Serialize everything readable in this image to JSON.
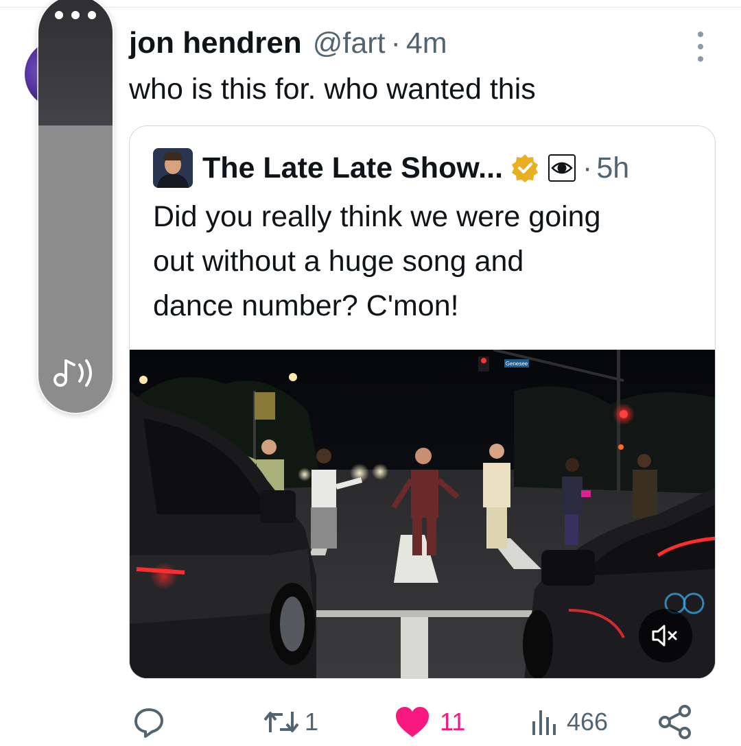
{
  "tweet": {
    "author_name": "jon hendren",
    "handle": "@fart",
    "separator": "·",
    "time": "4m",
    "text": "who is this for. who wanted this",
    "avatar_icon": "avatar-image",
    "more_icon": "more-vertical-icon"
  },
  "quote": {
    "author_name": "The Late Late Show...",
    "verified_icon": "verified-badge-icon",
    "network_icon": "cbs-eye-logo",
    "separator": "·",
    "time": "5h",
    "text_lines": [
      "Did you really think we were going",
      "out without a huge song and",
      "dance number? C'mon!"
    ],
    "media": {
      "street_sign": "Genesee",
      "mute_icon": "volume-muted-icon"
    }
  },
  "actions": {
    "reply_icon": "reply-icon",
    "retweet_icon": "retweet-icon",
    "retweet_count": "1",
    "like_icon": "heart-icon-filled",
    "like_count": "11",
    "like_color": "#f91880",
    "views_icon": "views-bar-icon",
    "views_count": "466",
    "share_icon": "share-icon"
  },
  "overlay": {
    "menu_icon": "ellipsis-icon",
    "audio_icon": "audio-note-icon"
  }
}
